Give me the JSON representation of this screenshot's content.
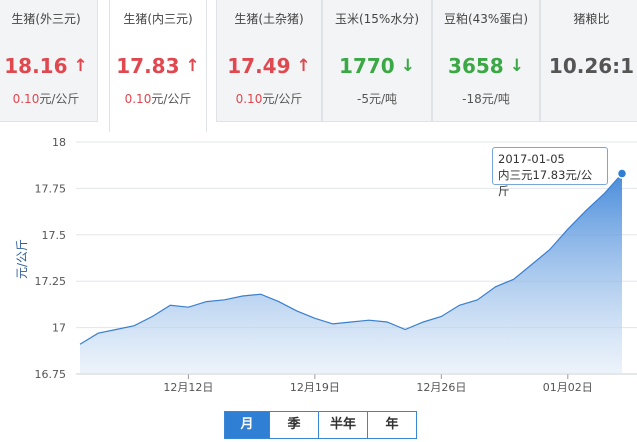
{
  "tabs": [
    {
      "name": "生猪(外三元)",
      "price": "18.16",
      "direction": "up",
      "change": "0.10",
      "unit": "元/公斤"
    },
    {
      "name": "生猪(内三元)",
      "price": "17.83",
      "direction": "up",
      "change": "0.10",
      "unit": "元/公斤",
      "active": true
    },
    {
      "name": "生猪(土杂猪)",
      "price": "17.49",
      "direction": "up",
      "change": "0.10",
      "unit": "元/公斤"
    },
    {
      "name": "玉米(15%水分)",
      "price": "1770",
      "direction": "down",
      "change": "-5",
      "unit": "元/吨"
    },
    {
      "name": "豆粕(43%蛋白)",
      "price": "3658",
      "direction": "down",
      "change": "-18",
      "unit": "元/吨"
    },
    {
      "name": "猪粮比",
      "price": "10.26:1",
      "direction": "none",
      "change": "",
      "unit": ""
    }
  ],
  "colors": {
    "up": "#e0484f",
    "down": "#3aa844",
    "accent": "#2f7fd4"
  },
  "icons": {
    "up": "arrow-up-icon",
    "down": "arrow-down-icon"
  },
  "tooltip": {
    "date": "2017-01-05",
    "text": "内三元17.83元/公斤"
  },
  "range_buttons": [
    {
      "label": "月",
      "active": true
    },
    {
      "label": "季"
    },
    {
      "label": "半年"
    },
    {
      "label": "年"
    }
  ],
  "chart_data": {
    "type": "area",
    "ylabel": "元/公斤",
    "ylim": [
      16.75,
      18
    ],
    "yticks": [
      18,
      17.75,
      17.5,
      17.25,
      17,
      16.75
    ],
    "xticks": [
      {
        "date": "2016-12-12",
        "label": "12月12日"
      },
      {
        "date": "2016-12-19",
        "label": "12月19日"
      },
      {
        "date": "2016-12-26",
        "label": "12月26日"
      },
      {
        "date": "2017-01-02",
        "label": "01月02日"
      }
    ],
    "grid": true,
    "series": [
      {
        "name": "内三元",
        "x": [
          "2016-12-06",
          "2016-12-07",
          "2016-12-08",
          "2016-12-09",
          "2016-12-10",
          "2016-12-11",
          "2016-12-12",
          "2016-12-13",
          "2016-12-14",
          "2016-12-15",
          "2016-12-16",
          "2016-12-17",
          "2016-12-18",
          "2016-12-19",
          "2016-12-20",
          "2016-12-21",
          "2016-12-22",
          "2016-12-23",
          "2016-12-24",
          "2016-12-25",
          "2016-12-26",
          "2016-12-27",
          "2016-12-28",
          "2016-12-29",
          "2016-12-30",
          "2016-12-31",
          "2017-01-01",
          "2017-01-02",
          "2017-01-03",
          "2017-01-04",
          "2017-01-05"
        ],
        "values": [
          16.91,
          16.97,
          16.99,
          17.01,
          17.06,
          17.12,
          17.11,
          17.14,
          17.15,
          17.17,
          17.18,
          17.14,
          17.09,
          17.05,
          17.02,
          17.03,
          17.04,
          17.03,
          16.99,
          17.03,
          17.06,
          17.12,
          17.15,
          17.22,
          17.26,
          17.34,
          17.42,
          17.53,
          17.63,
          17.72,
          17.83
        ]
      }
    ]
  }
}
